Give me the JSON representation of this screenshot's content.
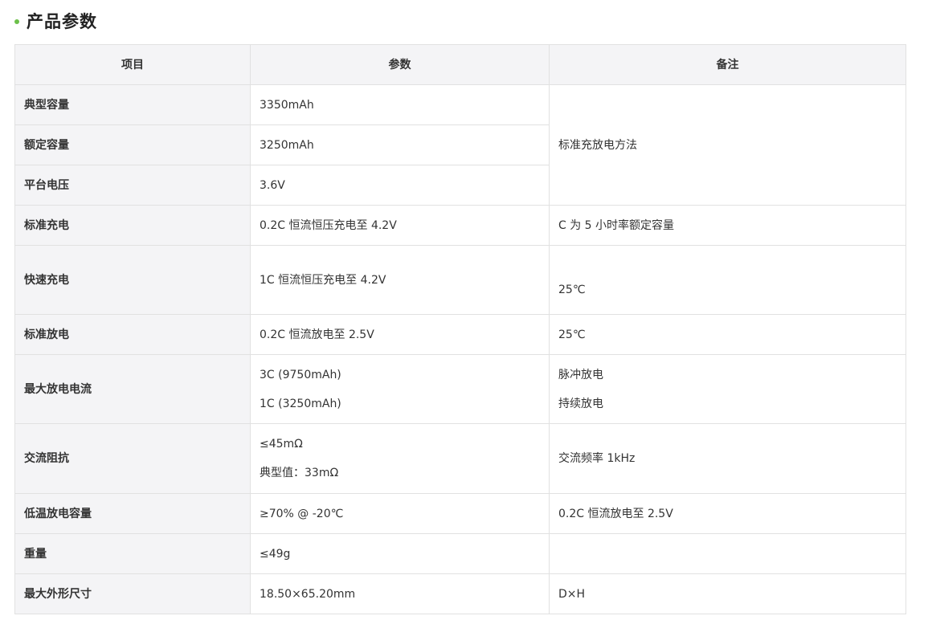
{
  "section": {
    "title": "产品参数",
    "accent_color": "#6cc04a"
  },
  "table": {
    "headers": [
      "项目",
      "参数",
      "备注"
    ],
    "rows": [
      {
        "item": "典型容量",
        "value": "3350mAh"
      },
      {
        "item": "额定容量",
        "value": "3250mAh"
      },
      {
        "item": "平台电压",
        "value": "3.6V"
      },
      {
        "item": "标准充电",
        "value": "0.2C 恒流恒压充电至 4.2V",
        "note": "C 为 5 小时率额定容量"
      },
      {
        "item": "快速充电",
        "value": "1C 恒流恒压充电至 4.2V",
        "note": "25℃"
      },
      {
        "item": "标准放电",
        "value": "0.2C 恒流放电至 2.5V",
        "note": "25℃"
      },
      {
        "item": "最大放电电流",
        "values": [
          "3C (9750mAh)",
          "1C (3250mAh)"
        ],
        "notes": [
          "脉冲放电",
          "持续放电"
        ]
      },
      {
        "item": "交流阻抗",
        "values": [
          "≤45mΩ",
          "典型值：33mΩ"
        ],
        "note": "交流频率 1kHz"
      },
      {
        "item": "低温放电容量",
        "value": "≥70% @ -20℃",
        "note": "0.2C 恒流放电至 2.5V"
      },
      {
        "item": "重量",
        "value": "≤49g",
        "note": ""
      },
      {
        "item": "最大外形尺寸",
        "value": "18.50×65.20mm",
        "note": "D×H"
      }
    ],
    "merged_note": "标准充放电方法"
  }
}
